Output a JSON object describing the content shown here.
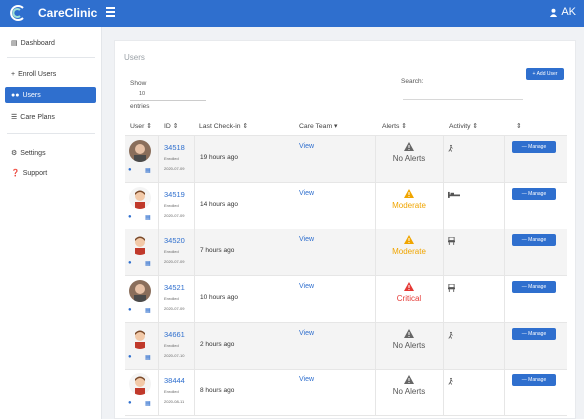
{
  "app": {
    "brand": "CareClinic",
    "user": "AK"
  },
  "sidebar": {
    "items": [
      {
        "label": "Dashboard"
      },
      {
        "label": "Enroll Users"
      },
      {
        "label": "Users"
      },
      {
        "label": "Care Plans"
      },
      {
        "label": "Settings"
      },
      {
        "label": "Support"
      }
    ]
  },
  "page": {
    "title": "Users",
    "add_label": "+ Add User",
    "show_label": "Show",
    "show_value": "10",
    "entries_label": "entries",
    "search_label": "Search:"
  },
  "table": {
    "headers": [
      "User",
      "ID",
      "Last Check-in",
      "Care Team",
      "Alerts",
      "Activity",
      ""
    ],
    "rows": [
      {
        "id": "34518",
        "status": "Enrolled",
        "date": "2020-07-09",
        "checkin": "19 hours ago",
        "team": "View",
        "alert": "No Alerts",
        "manage": "— Manage"
      },
      {
        "id": "34519",
        "status": "Enrolled",
        "date": "2020-07-09",
        "checkin": "14 hours ago",
        "team": "View",
        "alert": "Moderate",
        "manage": "— Manage"
      },
      {
        "id": "34520",
        "status": "Enrolled",
        "date": "2020-07-09",
        "checkin": "7 hours ago",
        "team": "View",
        "alert": "Moderate",
        "manage": "— Manage"
      },
      {
        "id": "34521",
        "status": "Enrolled",
        "date": "2020-07-09",
        "checkin": "10 hours ago",
        "team": "View",
        "alert": "Critical",
        "manage": "— Manage"
      },
      {
        "id": "34661",
        "status": "Enrolled",
        "date": "2020-07-10",
        "checkin": "2 hours ago",
        "team": "View",
        "alert": "No Alerts",
        "manage": "— Manage"
      },
      {
        "id": "38444",
        "status": "Enrolled",
        "date": "2020-08-11",
        "checkin": "8 hours ago",
        "team": "View",
        "alert": "No Alerts",
        "manage": "— Manage"
      }
    ]
  },
  "colors": {
    "primary": "#2f6fce",
    "moderate": "#f0a500",
    "critical": "#e53935",
    "none": "#555555"
  }
}
